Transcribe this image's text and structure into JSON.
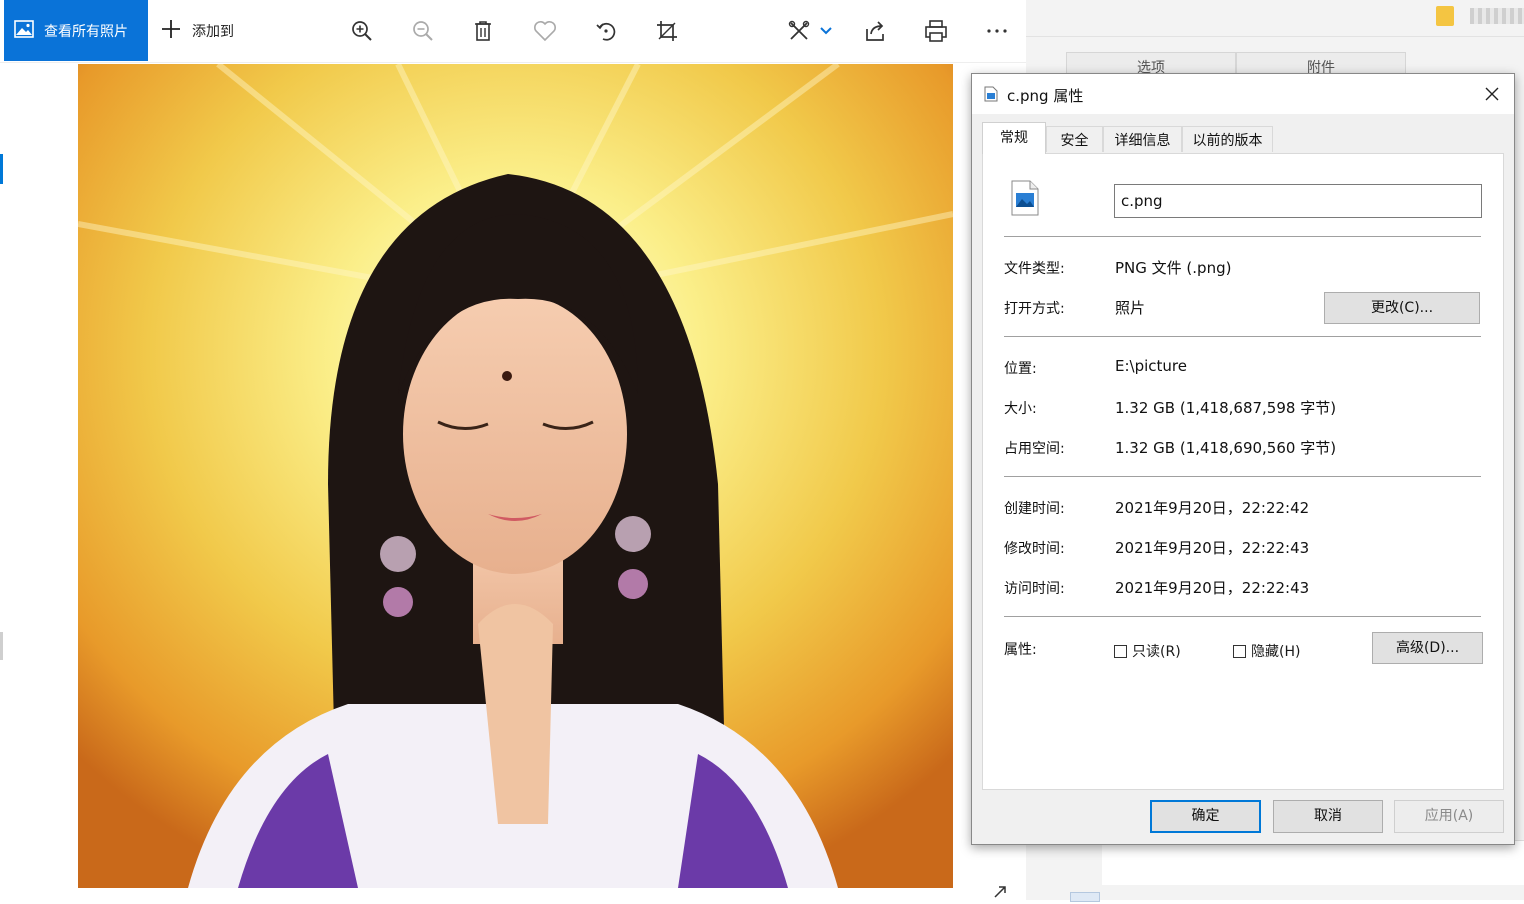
{
  "toolbar": {
    "view_all_label": "查看所有照片",
    "add_to_label": "添加到"
  },
  "background_window": {
    "tab_options": "选项",
    "tab_attachments": "附件"
  },
  "dialog": {
    "title": "c.png 属性",
    "tabs": [
      "常规",
      "安全",
      "详细信息",
      "以前的版本"
    ],
    "file_name": "c.png",
    "type_label": "文件类型:",
    "type_value": "PNG 文件 (.png)",
    "open_with_label": "打开方式:",
    "open_with_value": "照片",
    "change_button": "更改(C)...",
    "location_label": "位置:",
    "location_value": "E:\\picture",
    "size_label": "大小:",
    "size_value": "1.32 GB (1,418,687,598 字节)",
    "size_on_disk_label": "占用空间:",
    "size_on_disk_value": "1.32 GB (1,418,690,560 字节)",
    "created_label": "创建时间:",
    "created_value": "2021年9月20日，22:22:42",
    "modified_label": "修改时间:",
    "modified_value": "2021年9月20日，22:22:43",
    "accessed_label": "访问时间:",
    "accessed_value": "2021年9月20日，22:22:43",
    "attributes_label": "属性:",
    "readonly_label": "只读(R)",
    "hidden_label": "隐藏(H)",
    "advanced_button": "高级(D)...",
    "ok_button": "确定",
    "cancel_button": "取消",
    "apply_button": "应用(A)"
  },
  "colors": {
    "accent": "#0a73d8",
    "dialog_bg": "#f0f0f0"
  }
}
